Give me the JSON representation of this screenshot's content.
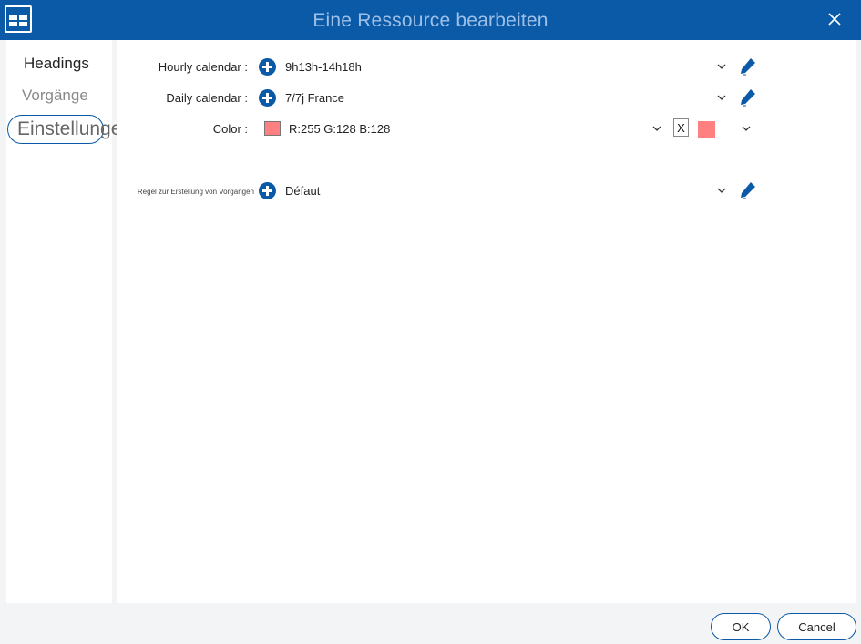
{
  "window": {
    "title": "Eine Ressource bearbeiten",
    "app_icon": "grid-window-icon",
    "close_icon": "close-icon"
  },
  "sidebar": {
    "items": [
      {
        "label": "Headings"
      },
      {
        "label": "Vorgänge"
      },
      {
        "label": "Einstellungen",
        "active": true
      }
    ]
  },
  "form": {
    "hourly": {
      "label": "Hourly calendar :",
      "value": "9h13h-14h18h"
    },
    "daily": {
      "label": "Daily calendar :",
      "value": "7/7j France"
    },
    "color": {
      "label": "Color :",
      "value": "R:255 G:128 B:128",
      "swatch": "#ff8080",
      "clear_label": "X"
    },
    "rule": {
      "label": "Regel zur Erstellung von Vorgängen",
      "value": "Défaut"
    }
  },
  "footer": {
    "ok_label": "OK",
    "cancel_label": "Cancel"
  },
  "colors": {
    "accent": "#0a5aa8",
    "swatch": "#ff8080"
  }
}
